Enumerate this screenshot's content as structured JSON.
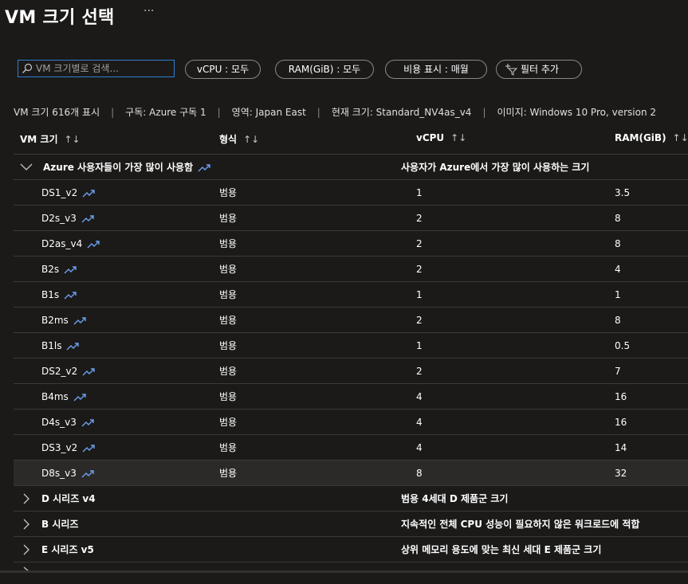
{
  "page": {
    "title": "VM 크기 선택",
    "more": "···"
  },
  "search": {
    "placeholder": "VM 크기별로 검색..."
  },
  "filters": [
    {
      "label": "vCPU : 모두"
    },
    {
      "label": "RAM(GiB) : 모두"
    },
    {
      "label": "비용 표시 : 매월"
    },
    {
      "label": "필터 추가"
    }
  ],
  "info": {
    "count": "VM 크기 616개 표시",
    "subscription": "구독: Azure 구독 1",
    "region": "영역: Japan East",
    "current": "현재 크기: Standard_NV4as_v4",
    "image": "이미지: Windows 10 Pro, version 2"
  },
  "columns": [
    "VM 크기",
    "형식",
    "vCPU",
    "RAM(GiB)"
  ],
  "group_popular": {
    "label": "Azure 사용자들이 가장 많이 사용함",
    "desc": "사용자가 Azure에서 가장 많이 사용하는 크기"
  },
  "rows": [
    {
      "name": "DS1_v2",
      "type": "범용",
      "vcpu": "1",
      "ram": "3.5"
    },
    {
      "name": "D2s_v3",
      "type": "범용",
      "vcpu": "2",
      "ram": "8"
    },
    {
      "name": "D2as_v4",
      "type": "범용",
      "vcpu": "2",
      "ram": "8"
    },
    {
      "name": "B2s",
      "type": "범용",
      "vcpu": "2",
      "ram": "4"
    },
    {
      "name": "B1s",
      "type": "범용",
      "vcpu": "1",
      "ram": "1"
    },
    {
      "name": "B2ms",
      "type": "범용",
      "vcpu": "2",
      "ram": "8"
    },
    {
      "name": "B1ls",
      "type": "범용",
      "vcpu": "1",
      "ram": "0.5"
    },
    {
      "name": "DS2_v2",
      "type": "범용",
      "vcpu": "2",
      "ram": "7"
    },
    {
      "name": "B4ms",
      "type": "범용",
      "vcpu": "4",
      "ram": "16"
    },
    {
      "name": "D4s_v3",
      "type": "범용",
      "vcpu": "4",
      "ram": "16"
    },
    {
      "name": "DS3_v2",
      "type": "범용",
      "vcpu": "4",
      "ram": "14"
    },
    {
      "name": "D8s_v3",
      "type": "범용",
      "vcpu": "8",
      "ram": "32"
    }
  ],
  "groups": [
    {
      "label": "D 시리즈 v4",
      "desc": "범용 4세대 D 제품군 크기"
    },
    {
      "label": "B 시리즈",
      "desc": "지속적인 전체 CPU 성능이 필요하지 않은 워크로드에 적합"
    },
    {
      "label": "E 시리즈 v5",
      "desc": "상위 메모리 용도에 맞는 최신 세대 E 제품군 크기"
    }
  ],
  "colors": {
    "background": "#1b1a19",
    "accent": "#2f7fd1",
    "trend": "#6ca0f0"
  }
}
